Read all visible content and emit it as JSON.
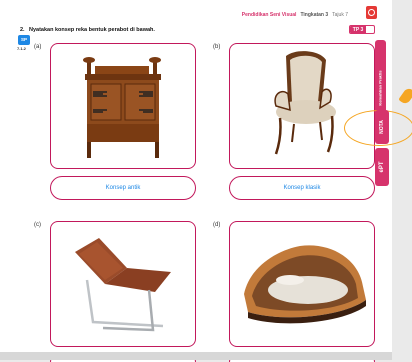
{
  "header": {
    "subject": "Pendidikan Seni Visual",
    "level": "Tingkatan 3",
    "topic": "Tajuk 7",
    "tp_badge": "TP 3"
  },
  "question": {
    "number": "2.",
    "text": "Nyatakan konsep reka bentuk perabot di bawah.",
    "sp_icon": "SP",
    "sp_code": "7.1.2"
  },
  "items": [
    {
      "label": "(a)",
      "answer": "Konsep antik"
    },
    {
      "label": "(b)",
      "answer": "Konsep klasik"
    },
    {
      "label": "(c)",
      "answer": ""
    },
    {
      "label": "(d)",
      "answer": ""
    }
  ],
  "side_tabs": {
    "competency": "Kemahiran Praktis",
    "nota": "NOTA",
    "app": "ePT"
  },
  "colors": {
    "accent": "#c2185b",
    "answer_text": "#1e88e5",
    "highlight": "#f5a623"
  }
}
